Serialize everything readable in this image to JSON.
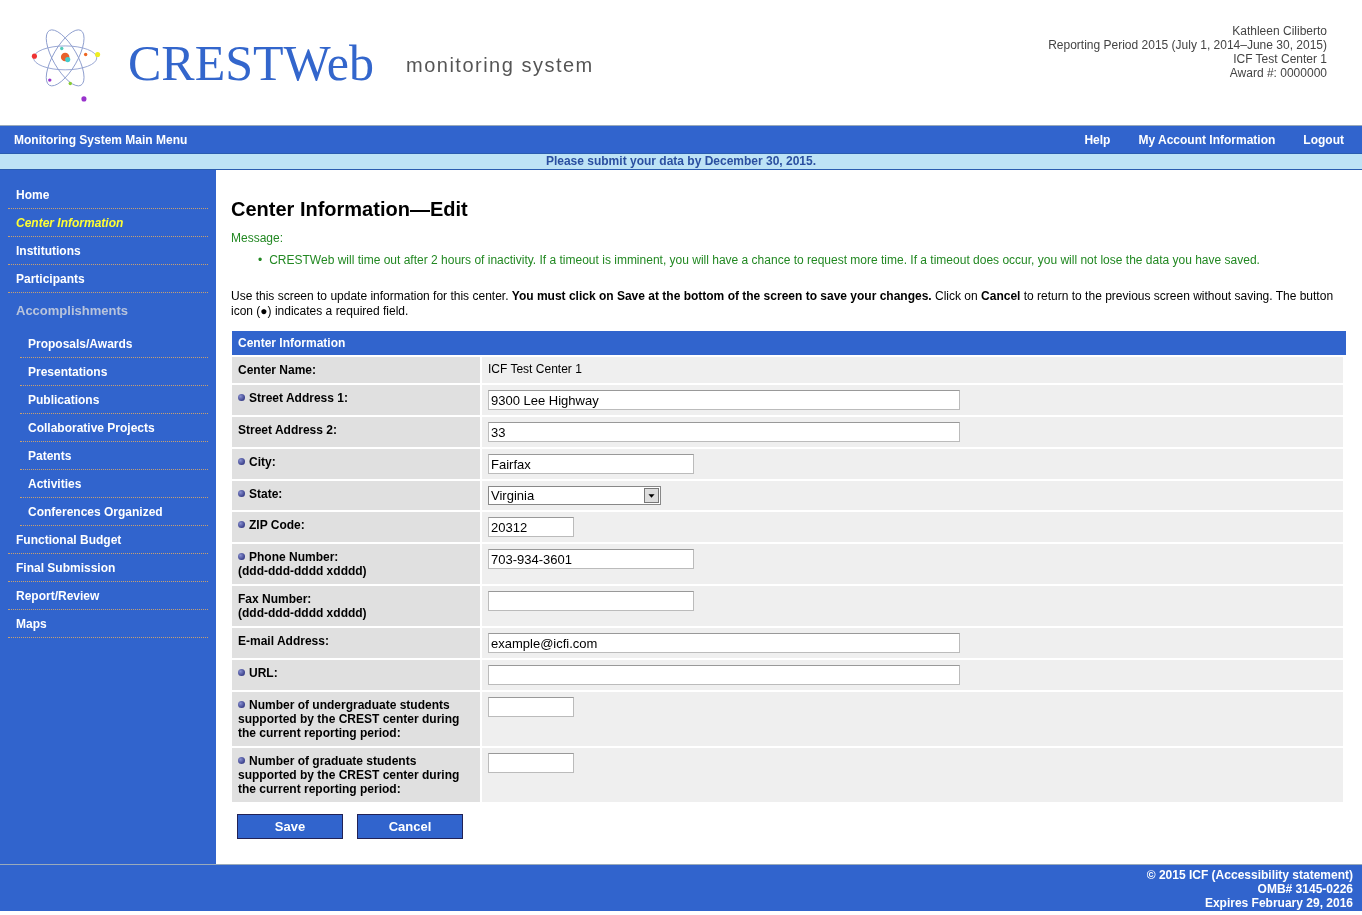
{
  "header": {
    "logo_text": "CRESTWeb",
    "tagline": "monitoring system",
    "user_info": [
      "Kathleen Ciliberto",
      "Reporting Period 2015 (July 1, 2014–June 30, 2015)",
      "ICF Test Center 1",
      "Award #: 0000000"
    ]
  },
  "nav": {
    "title": "Monitoring System Main Menu",
    "links": [
      "Help",
      "My Account Information",
      "Logout"
    ]
  },
  "notice": "Please submit your data by December 30, 2015.",
  "sidebar": {
    "items": [
      {
        "label": "Home",
        "kind": "link",
        "selected": false
      },
      {
        "label": "Center Information",
        "kind": "link",
        "selected": true
      },
      {
        "label": "Institutions",
        "kind": "link",
        "selected": false
      },
      {
        "label": "Participants",
        "kind": "link",
        "selected": false
      },
      {
        "label": "Accomplishments",
        "kind": "heading",
        "selected": false
      },
      {
        "label": "Proposals/Awards",
        "kind": "sub",
        "selected": false
      },
      {
        "label": "Presentations",
        "kind": "sub",
        "selected": false
      },
      {
        "label": "Publications",
        "kind": "sub",
        "selected": false
      },
      {
        "label": "Collaborative Projects",
        "kind": "sub",
        "selected": false
      },
      {
        "label": "Patents",
        "kind": "sub",
        "selected": false
      },
      {
        "label": "Activities",
        "kind": "sub",
        "selected": false
      },
      {
        "label": "Conferences Organized",
        "kind": "sub",
        "selected": false
      },
      {
        "label": "Functional Budget",
        "kind": "link",
        "selected": false
      },
      {
        "label": "Final Submission",
        "kind": "link",
        "selected": false
      },
      {
        "label": "Report/Review",
        "kind": "link",
        "selected": false
      },
      {
        "label": "Maps",
        "kind": "link",
        "selected": false
      }
    ]
  },
  "page": {
    "title": "Center Information—Edit",
    "message_label": "Message:",
    "bullet": "•",
    "messages": [
      "CRESTWeb will time out after 2 hours of inactivity. If a timeout is imminent, you will have a chance to request more time. If a timeout does occur, you will not lose the data you have saved."
    ],
    "intro": "Use this screen to update information for this center. **You must click on Save at the bottom of the screen to save your changes.** Click on **Cancel** to return to the previous screen without saving. The button icon (●) indicates a required field."
  },
  "form": {
    "title": "Center Information",
    "rows": [
      {
        "label": "Center Name:",
        "kind": "static",
        "required": false,
        "value": "ICF Test Center 1"
      },
      {
        "label": "Street Address 1:",
        "kind": "text_long",
        "required": true,
        "value": "9300 Lee Highway"
      },
      {
        "label": "Street Address 2:",
        "kind": "text_long",
        "required": false,
        "value": "33"
      },
      {
        "label": "City:",
        "kind": "text_medium",
        "required": true,
        "value": "Fairfax"
      },
      {
        "label": "State:",
        "kind": "select",
        "required": true,
        "value": "Virginia"
      },
      {
        "label": "ZIP Code:",
        "kind": "text_short",
        "required": true,
        "value": "20312"
      },
      {
        "label": "Phone Number:",
        "hint": "(ddd-ddd-dddd xdddd)",
        "kind": "text_medium",
        "required": true,
        "value": "703-934-3601"
      },
      {
        "label": "Fax Number:",
        "hint": "(ddd-ddd-dddd xdddd)",
        "kind": "text_medium",
        "required": false
      },
      {
        "label": "E-mail Address:",
        "kind": "text_long",
        "required": false,
        "value": "example@icfi.com"
      },
      {
        "label": "URL:",
        "kind": "text_long",
        "required": true
      },
      {
        "label": "Number of undergraduate students supported by the CREST center during the current reporting period:",
        "kind": "text_short",
        "required": true
      },
      {
        "label": "Number of graduate students supported by the CREST center during the current reporting period:",
        "kind": "text_short",
        "required": true
      }
    ],
    "buttons": [
      "Save",
      "Cancel"
    ]
  },
  "footer": [
    "© 2015 ICF (Accessibility statement)",
    "OMB# 3145-0226",
    "Expires February 29, 2016"
  ]
}
